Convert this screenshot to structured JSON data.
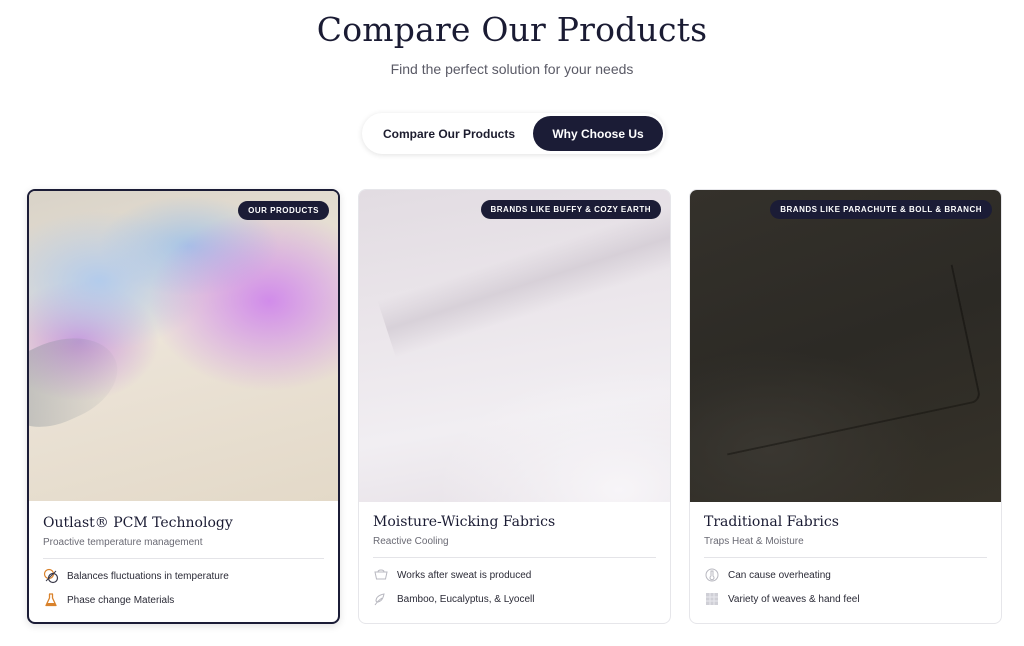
{
  "header": {
    "title": "Compare Our Products",
    "subtitle": "Find the perfect solution for your needs"
  },
  "toggle": {
    "options": [
      "Compare Our Products",
      "Why Choose Us"
    ],
    "active": "Why Choose Us"
  },
  "cards": [
    {
      "badge": "OUR PRODUCTS",
      "title": "Outlast® PCM Technology",
      "subtitle": "Proactive temperature management",
      "features": [
        {
          "icon": "balance-circles-icon",
          "text": "Balances fluctuations in temperature"
        },
        {
          "icon": "flask-icon",
          "text": "Phase change Materials"
        }
      ],
      "selected": true
    },
    {
      "badge": "BRANDS LIKE BUFFY & COZY EARTH",
      "title": "Moisture-Wicking Fabrics",
      "subtitle": "Reactive Cooling",
      "features": [
        {
          "icon": "basin-icon",
          "text": "Works after sweat is produced"
        },
        {
          "icon": "leaf-icon",
          "text": "Bamboo, Eucalyptus, & Lyocell"
        }
      ],
      "selected": false
    },
    {
      "badge": "BRANDS LIKE PARACHUTE & BOLL & BRANCH",
      "title": "Traditional Fabrics",
      "subtitle": "Traps Heat & Moisture",
      "features": [
        {
          "icon": "heat-icon",
          "text": "Can cause overheating"
        },
        {
          "icon": "weave-icon",
          "text": "Variety of weaves & hand feel"
        }
      ],
      "selected": false
    }
  ],
  "colors": {
    "navy": "#1b1c36",
    "accent_orange": "#d9822b"
  }
}
